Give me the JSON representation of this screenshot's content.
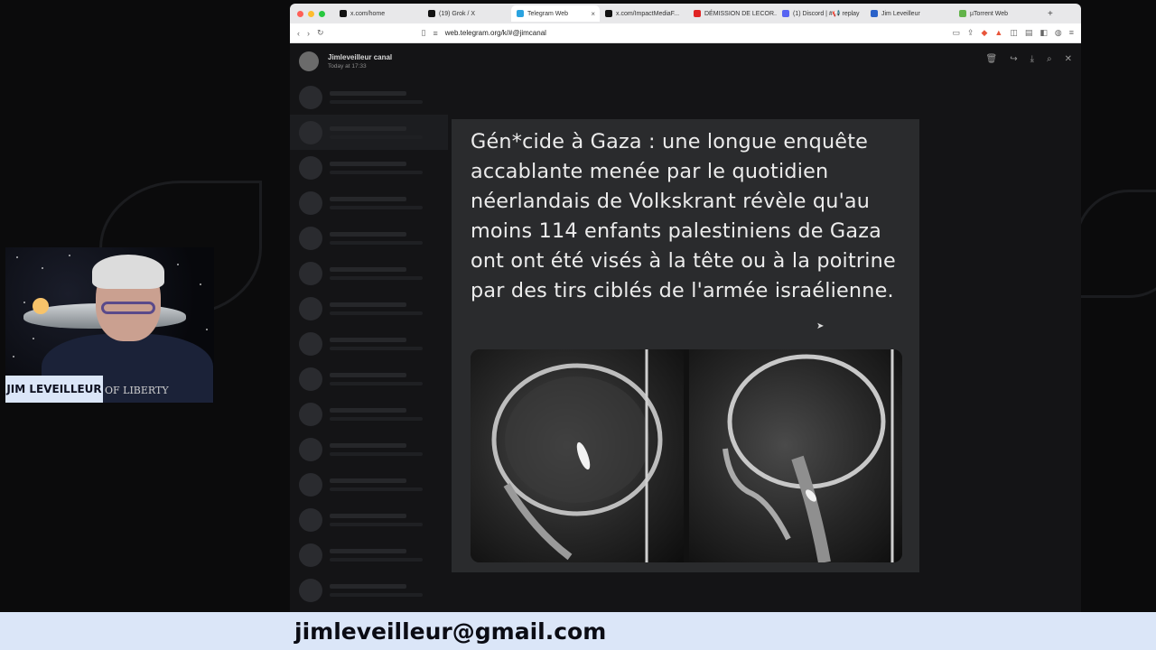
{
  "browser": {
    "tabs": [
      {
        "label": "x.com/home",
        "fav_color": "#111111",
        "active": false
      },
      {
        "label": "(19) Grok / X",
        "fav_color": "#111111",
        "active": false
      },
      {
        "label": "Telegram Web",
        "fav_color": "#2aa3e0",
        "active": true
      },
      {
        "label": "x.com/ImpactMediaF...",
        "fav_color": "#111111",
        "active": false
      },
      {
        "label": "DÉMISSION DE LECOR...",
        "fav_color": "#e02424",
        "active": false
      },
      {
        "label": "(1) Discord | #📢 replay",
        "fav_color": "#5865f2",
        "active": false
      },
      {
        "label": "Jim Leveilleur",
        "fav_color": "#2a62c9",
        "active": false
      },
      {
        "label": "µTorrent Web",
        "fav_color": "#62b34a",
        "active": false
      }
    ],
    "url": "web.telegram.org/k/#@jimcanal"
  },
  "telegram": {
    "channel_name": "Jimleveilleur canal",
    "channel_time": "Today at 17:33"
  },
  "post": {
    "text": "Gén*cide à Gaza : une longue enquête accablante menée par le quotidien néerlandais de Volkskrant révèle qu'au moins 114 enfants palestiniens de Gaza ont ont été visés à la tête ou à la poitrine par des tirs ciblés de l'armée israélienne."
  },
  "webcam": {
    "shirt_text": "OF LIBERTY",
    "name_tag": "JIM LEVEILLEUR"
  },
  "banner": {
    "email": "jimleveilleur@gmail.com"
  },
  "colors": {
    "banner_bg": "#dbe6f8",
    "post_bg": "#2a2b2d"
  }
}
